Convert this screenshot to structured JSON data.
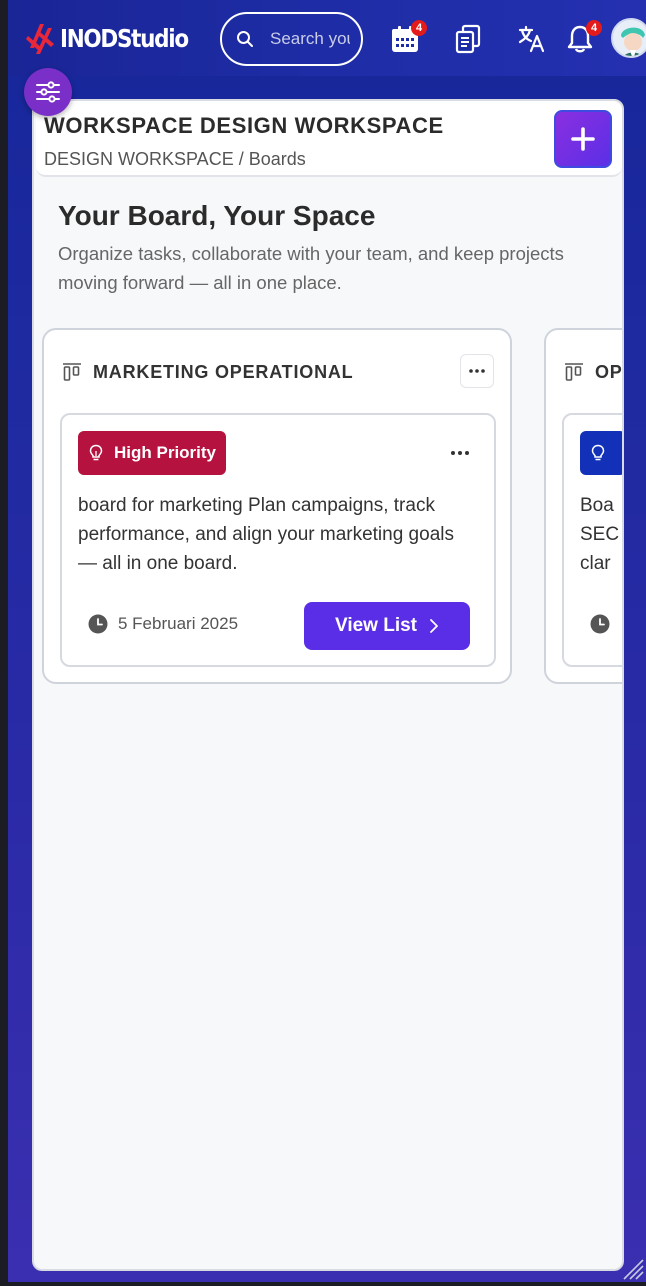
{
  "brand": {
    "name": "INODStudio"
  },
  "search": {
    "placeholder": "Search your"
  },
  "toolbar": {
    "calendar_badge": "4",
    "notification_badge": "4"
  },
  "workspace": {
    "title": "WORKSPACE DESIGN WORKSPACE",
    "breadcrumb": "DESIGN WORKSPACE / Boards"
  },
  "hero": {
    "title": "Your Board, Your Space",
    "subtitle": "Organize tasks, collaborate with your team, and keep projects moving forward — all in one place."
  },
  "boards": [
    {
      "title": "MARKETING OPERATIONAL",
      "card": {
        "priority": "High Priority",
        "description": "board for marketing Plan campaigns, track performance, and align your marketing goals — all in one board.",
        "date": "5 Februari 2025",
        "button": "View List"
      }
    },
    {
      "title": "OP",
      "card": {
        "description_lines": [
          "Boa",
          "SEC",
          "clar"
        ]
      }
    }
  ],
  "colors": {
    "high_priority": "#b5123f",
    "accent": "#5a2ee6",
    "header_bg": "#1a2596"
  }
}
